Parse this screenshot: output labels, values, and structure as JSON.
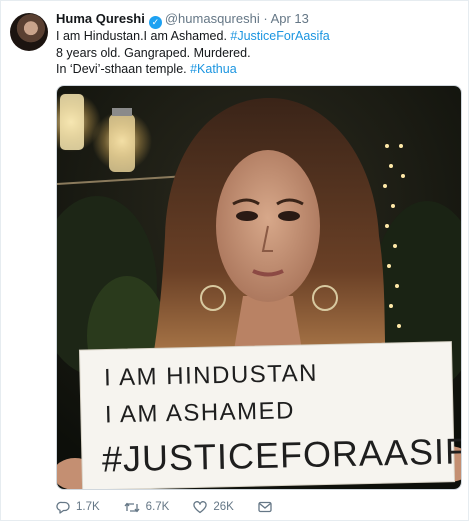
{
  "tweet": {
    "author_name": "Huma Qureshi",
    "handle": "@humasqureshi",
    "separator": "·",
    "date": "Apr 13",
    "lines": {
      "line1_text": "I am Hindustan.I am Ashamed. ",
      "line1_hashtag": "#JusticeForAasifa",
      "line2": "8 years old. Gangraped. Murdered.",
      "line3_text": "In ‘Devi’-sthaan temple. ",
      "line3_hashtag": "#Kathua"
    },
    "image": {
      "sign_lines": [
        "I AM HINDUSTAN",
        "I AM ASHAMED",
        "#JUSTICEFORAASIF"
      ]
    },
    "actions": {
      "replies": "1.7K",
      "retweets": "6.7K",
      "likes": "26K"
    },
    "colors": {
      "link": "#1b95e0",
      "verified": "#1da1f2",
      "meta": "#657786"
    },
    "icons": [
      "verified-badge-icon",
      "reply-icon",
      "retweet-icon",
      "like-icon",
      "message-icon"
    ]
  }
}
